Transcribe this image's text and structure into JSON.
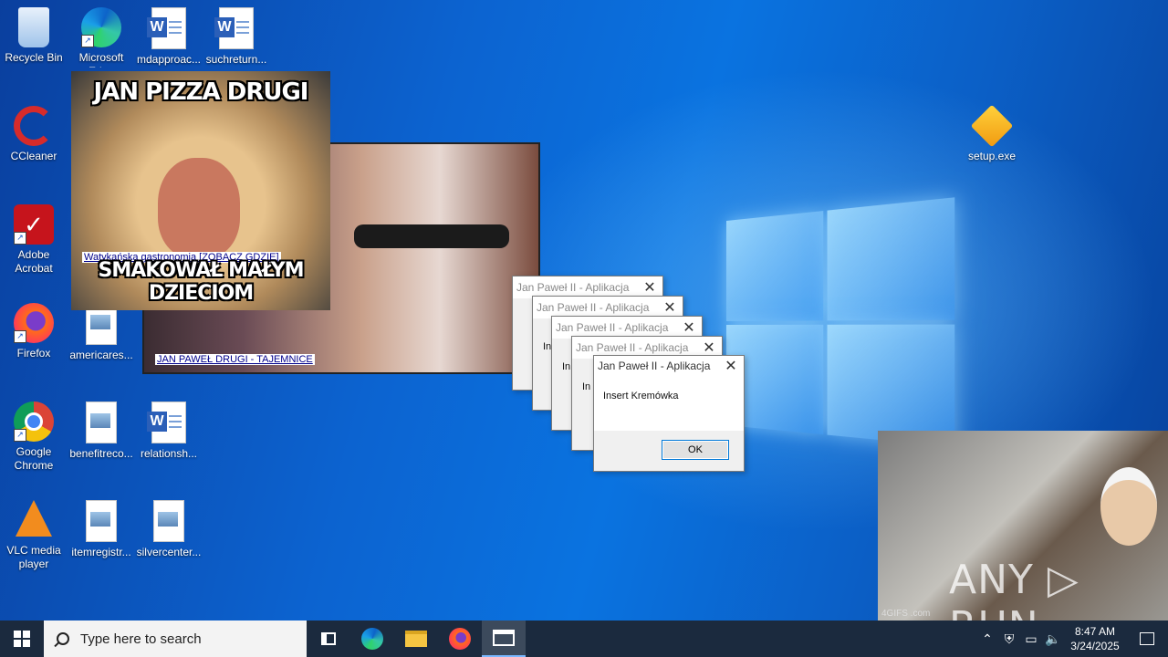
{
  "desktop": {
    "icons": [
      {
        "label": "Recycle Bin"
      },
      {
        "label": "Microsoft Edge"
      },
      {
        "label": "mdapproac..."
      },
      {
        "label": "suchreturn..."
      },
      {
        "label": "CCleaner"
      },
      {
        "label": "Adobe Acrobat"
      },
      {
        "label": "americares..."
      },
      {
        "label": "Firefox"
      },
      {
        "label": "Google Chrome"
      },
      {
        "label": "benefitreco..."
      },
      {
        "label": "relationsh..."
      },
      {
        "label": "VLC media player"
      },
      {
        "label": "itemregistr..."
      },
      {
        "label": "silvercenter..."
      },
      {
        "label": "setup.exe"
      }
    ]
  },
  "popups": {
    "meme1": {
      "top_text": "JAN PIZZA DRUGI",
      "link": "Watykańska gastronomia [ZOBACZ GDZIE]",
      "bottom_text": "SMAKOWAŁ MAŁYM DZIECIOM"
    },
    "meme2": {
      "link": "JAN PAWEŁ DRUGI - TAJEMNICE"
    },
    "meme3": {
      "gif_label": "4GIFS .com"
    }
  },
  "dialogs": {
    "title": "Jan Paweł II - Aplikacja",
    "stub_title_1": "Jan Paweł II - Aplikacja",
    "stub_title_2": "Jan Paweł II - Aplikacja",
    "stub_text": "In",
    "message": "Insert Kremówka",
    "ok_label": "OK"
  },
  "watermark": "ANY ▷ RUN",
  "taskbar": {
    "search_placeholder": "Type here to search",
    "time": "8:47 AM",
    "date": "3/24/2025"
  }
}
